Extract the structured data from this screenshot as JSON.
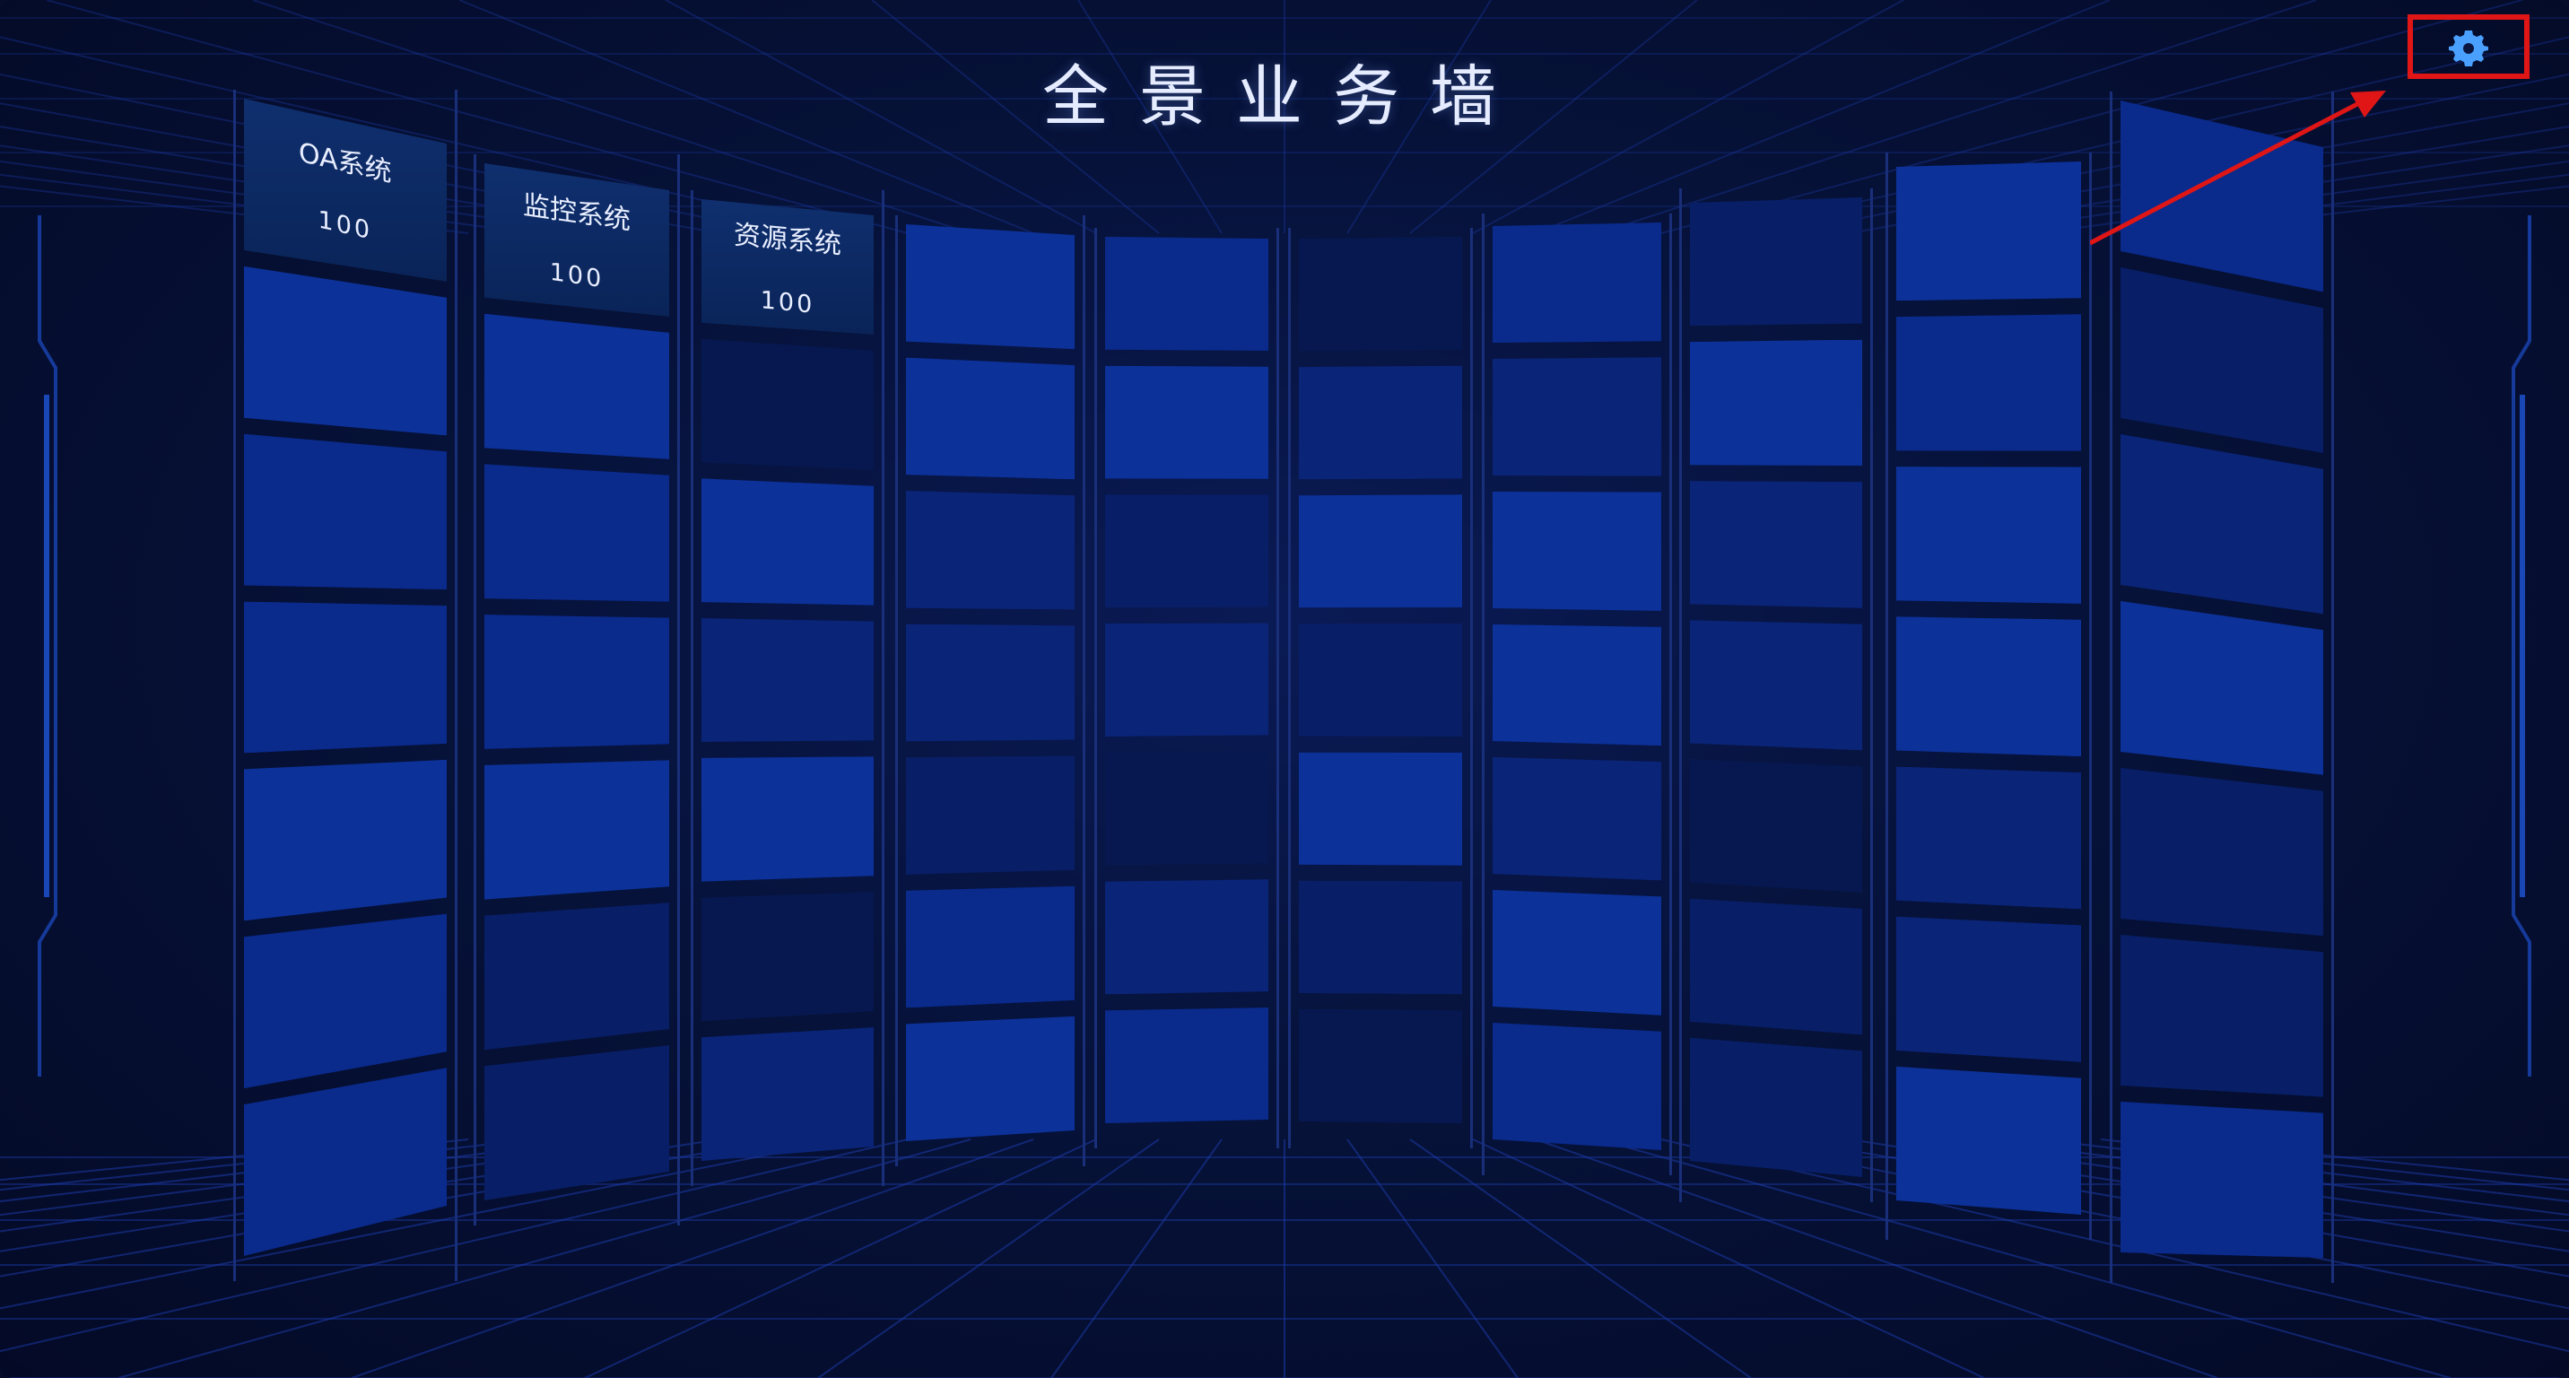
{
  "app": {
    "title": "全景业务墙"
  },
  "toolbar": {
    "settings_icon": "gear-icon",
    "settings_highlight_color": "#e01616",
    "arrow_color": "#e01616"
  },
  "colors": {
    "background": "#050d2b",
    "grid_line": "#1c3aa8",
    "title_text": "#e6ecff",
    "gear": "#4aa0ff",
    "tile_shades": [
      "#0a2a8c",
      "#0c3199",
      "#0a2478",
      "#081e66",
      "#06184f",
      "#0e37a8"
    ]
  },
  "wall": {
    "columns": 10,
    "rows": 7,
    "labeled_tiles": [
      {
        "name": "OA系统",
        "count": "100"
      },
      {
        "name": "监控系统",
        "count": "100"
      },
      {
        "name": "资源系统",
        "count": "100"
      }
    ],
    "shade_pattern": [
      [
        0,
        1,
        0,
        0,
        1,
        0
      ],
      [
        3,
        1,
        0,
        0,
        1,
        3
      ],
      [
        2,
        4,
        1,
        2,
        1,
        4
      ],
      [
        1,
        1,
        2,
        2,
        3,
        0
      ],
      [
        0,
        1,
        3,
        2,
        4,
        2
      ],
      [
        4,
        2,
        1,
        3,
        1,
        3
      ],
      [
        0,
        2,
        1,
        1,
        2,
        1
      ],
      [
        3,
        1,
        2,
        2,
        4,
        3
      ],
      [
        1,
        0,
        1,
        1,
        2,
        2
      ],
      [
        0,
        3,
        2,
        1,
        3,
        3
      ]
    ]
  }
}
